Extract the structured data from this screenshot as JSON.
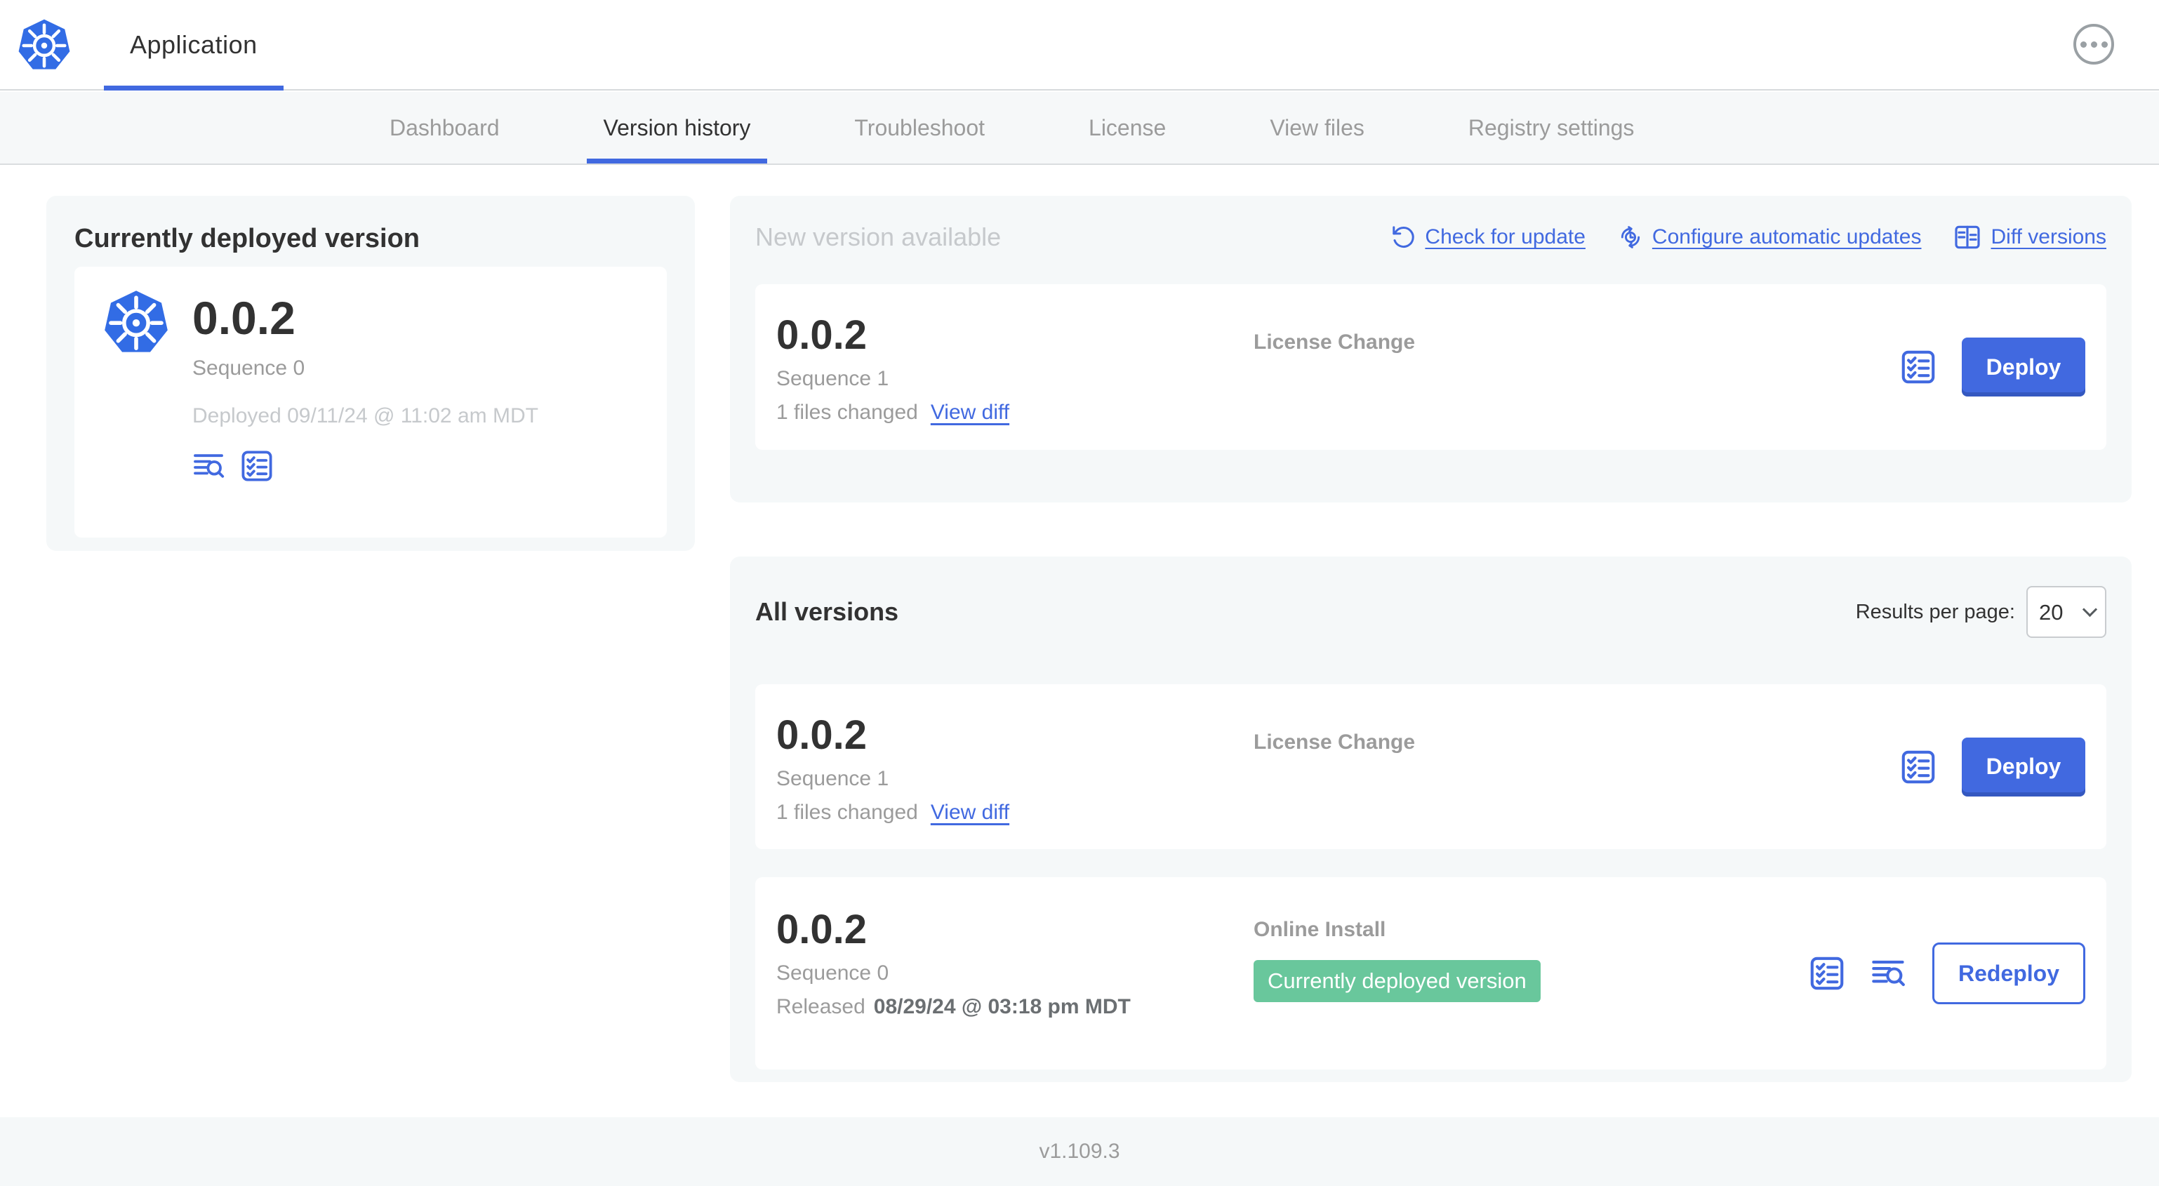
{
  "header": {
    "app_title": "Application"
  },
  "nav": {
    "tabs": [
      {
        "label": "Dashboard",
        "active": false
      },
      {
        "label": "Version history",
        "active": true
      },
      {
        "label": "Troubleshoot",
        "active": false
      },
      {
        "label": "License",
        "active": false
      },
      {
        "label": "View files",
        "active": false
      },
      {
        "label": "Registry settings",
        "active": false
      }
    ]
  },
  "current_version": {
    "title": "Currently deployed version",
    "version": "0.0.2",
    "sequence": "Sequence 0",
    "deployed": "Deployed 09/11/24 @ 11:02 am MDT"
  },
  "new_version": {
    "heading": "New version available",
    "actions": [
      {
        "label": "Check for update",
        "icon": "refresh-icon"
      },
      {
        "label": "Configure automatic updates",
        "icon": "schedule-update-icon"
      },
      {
        "label": "Diff versions",
        "icon": "diff-icon"
      }
    ],
    "row": {
      "version": "0.0.2",
      "sequence": "Sequence 1",
      "changes": "1 files changed",
      "view_diff": "View diff",
      "source": "License Change",
      "deploy_label": "Deploy"
    }
  },
  "all_versions": {
    "heading": "All versions",
    "results_per_page_label": "Results per page:",
    "results_per_page_value": "20",
    "rows": [
      {
        "version": "0.0.2",
        "sequence": "Sequence 1",
        "changes": "1 files changed",
        "view_diff": "View diff",
        "source": "License Change",
        "action_label": "Deploy"
      },
      {
        "version": "0.0.2",
        "sequence": "Sequence 0",
        "released_prefix": "Released",
        "released_date": "08/29/24 @ 03:18 pm MDT",
        "source": "Online Install",
        "badge": "Currently deployed version",
        "action_label": "Redeploy"
      }
    ]
  },
  "footer": {
    "version": "v1.109.3"
  },
  "colors": {
    "accent_blue": "#4169e0",
    "k8s_blue": "#326ce5",
    "badge_green": "#69c79c",
    "dark_text": "#323232",
    "gray_text": "#9b9b9b",
    "muted_text": "#c6c9cc",
    "panel_bg": "#f5f8f9"
  }
}
